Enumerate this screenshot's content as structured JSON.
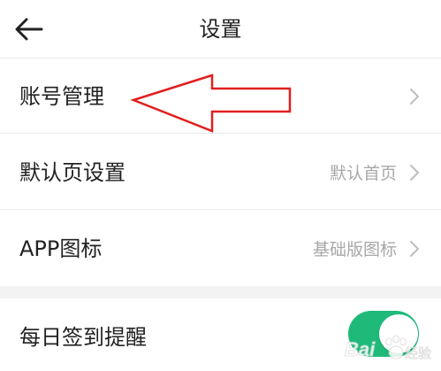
{
  "header": {
    "title": "设置",
    "back_icon": "arrow-left-icon"
  },
  "settings": {
    "items": [
      {
        "label": "账号管理",
        "value": ""
      },
      {
        "label": "默认页设置",
        "value": "默认首页"
      },
      {
        "label": "APP图标",
        "value": "基础版图标"
      }
    ],
    "chevron_icon": "chevron-right-icon"
  },
  "daily_reminder": {
    "label": "每日签到提醒",
    "enabled": true
  },
  "colors": {
    "toggle_on": "#1fba7a",
    "annotation_arrow": "#e02020",
    "primary_text": "#222222",
    "secondary_text": "#a8a8a8",
    "section_gap": "#f3f3f3"
  },
  "annotation": {
    "type": "red-outline-arrow",
    "points_to": "账号管理"
  },
  "watermark": {
    "text": "Bai 经验",
    "icon": "baidu-paw-icon"
  }
}
